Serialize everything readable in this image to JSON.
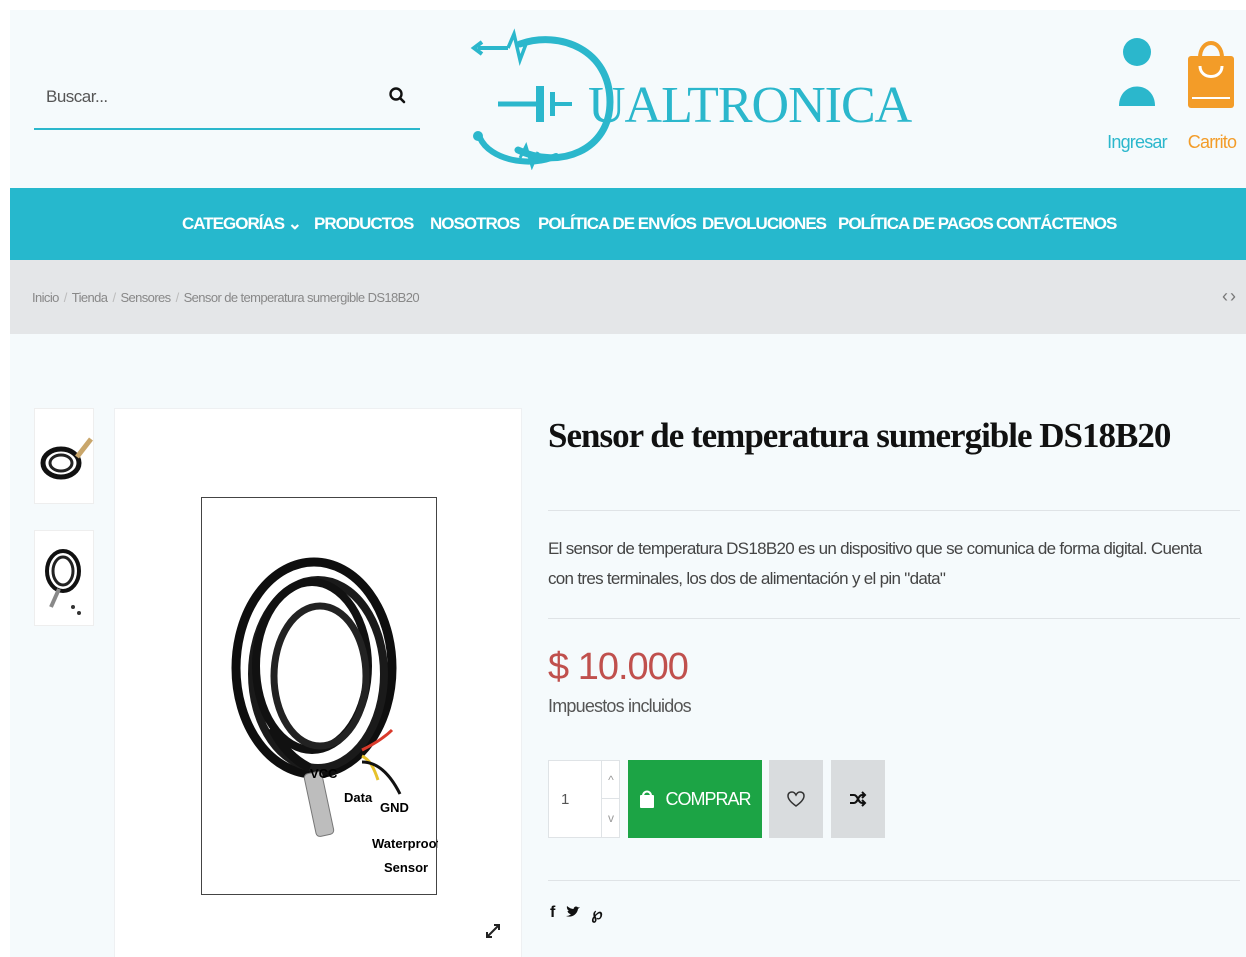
{
  "header": {
    "search": {
      "placeholder": "Buscar..."
    },
    "logo_text": "UALTRONICA",
    "account_label": "Ingresar",
    "cart_label": "Carrito"
  },
  "nav": {
    "items": [
      {
        "label": "CATEGORÍAS ⌄"
      },
      {
        "label": "PRODUCTOS"
      },
      {
        "label": "NOSOTROS"
      },
      {
        "label": "POLÍTICA DE ENVÍOS"
      },
      {
        "label": "DEVOLUCIONES"
      },
      {
        "label": "POLÍTICA DE PAGOS"
      },
      {
        "label": "CONTÁCTENOS"
      }
    ]
  },
  "breadcrumb": {
    "items": [
      "Inicio",
      "Tienda",
      "Sensores",
      "Sensor de temperatura sumergible DS18B20"
    ]
  },
  "product": {
    "title": "Sensor de temperatura sumergible DS18B20",
    "description": "El sensor de temperatura DS18B20 es un dispositivo que se comunica de forma digital. Cuenta con tres terminales, los dos de alimentación y el pin \"data\"",
    "price": "$ 10.000",
    "tax_note": "Impuestos incluidos",
    "quantity": "1",
    "buy_label": "COMPRAR",
    "image_labels": {
      "vcc": "VCC",
      "data": "Data",
      "gnd": "GND",
      "sensor_line1": "Waterproof",
      "sensor_line2": "Sensor"
    }
  },
  "colors": {
    "brand": "#26b8cd",
    "cart": "#f39c28",
    "buy": "#1ca445",
    "price": "#c0504d"
  }
}
